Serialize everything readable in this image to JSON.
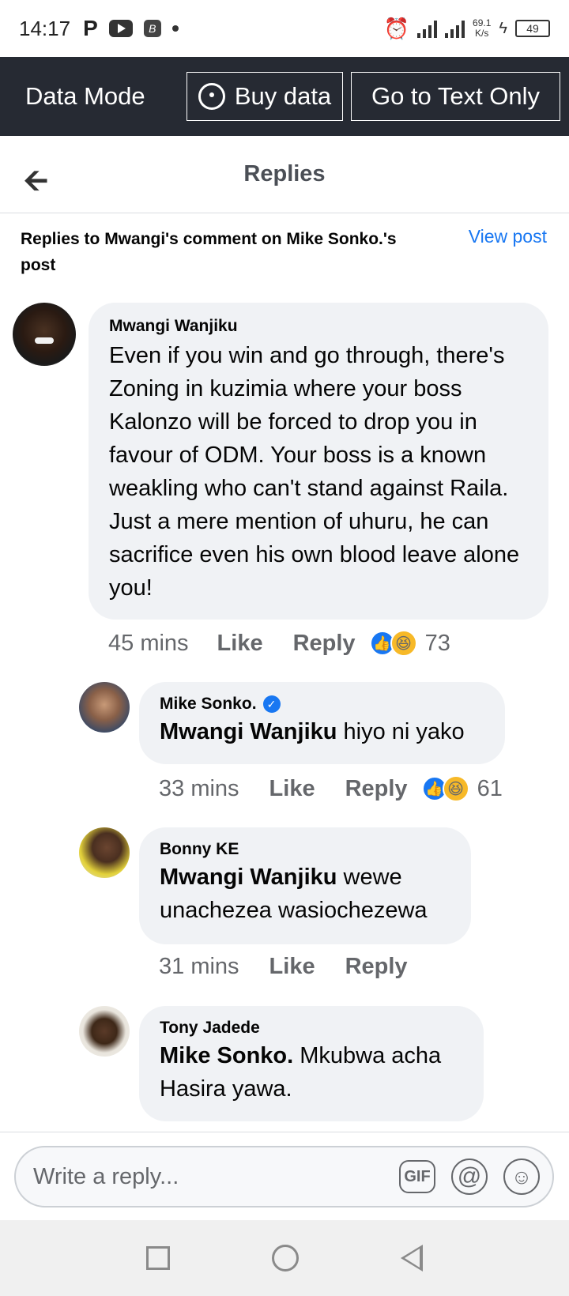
{
  "status_bar": {
    "time": "14:17",
    "p_icon": "P",
    "b_icon": "B",
    "speed_value": "69.1",
    "speed_unit": "K/s",
    "battery": "49"
  },
  "data_bar": {
    "mode_label": "Data Mode",
    "buy_label": "Buy data",
    "text_only_label": "Go to Text Only"
  },
  "header": {
    "title": "Replies",
    "back_icon": "arrow-left-icon"
  },
  "context": {
    "text": "Replies to Mwangi's comment on Mike Sonko.'s post",
    "view_post": "View post"
  },
  "comments": [
    {
      "author": "Mwangi Wanjiku",
      "text": "Even if you win and go through, there's Zoning in kuzimia where your boss Kalonzo will be forced to drop you in favour of ODM. Your boss is a known weakling who can't stand against Raila. Just a mere mention of uhuru, he can sacrifice even his own blood leave alone you!",
      "time": "45 mins",
      "like": "Like",
      "reply": "Reply",
      "reaction_count": "73"
    },
    {
      "author": "Mike Sonko.",
      "verified": true,
      "mention": "Mwangi Wanjiku",
      "text": " hiyo ni yako",
      "time": "33 mins",
      "like": "Like",
      "reply": "Reply",
      "reaction_count": "61"
    },
    {
      "author": "Bonny KE",
      "mention": "Mwangi Wanjiku",
      "text": " wewe unachezea wasiochezewa",
      "time": "31 mins",
      "like": "Like",
      "reply": "Reply"
    },
    {
      "author": "Tony Jadede",
      "mention": "Mike Sonko.",
      "text": " Mkubwa acha Hasira yawa."
    }
  ],
  "composer": {
    "placeholder": "Write a reply...",
    "gif_label": "GIF",
    "at_label": "@"
  },
  "colors": {
    "accent": "#1877f2",
    "data_bar_bg": "#262a33",
    "bubble_bg": "#f0f2f5",
    "reaction_haha": "#f7b928"
  }
}
